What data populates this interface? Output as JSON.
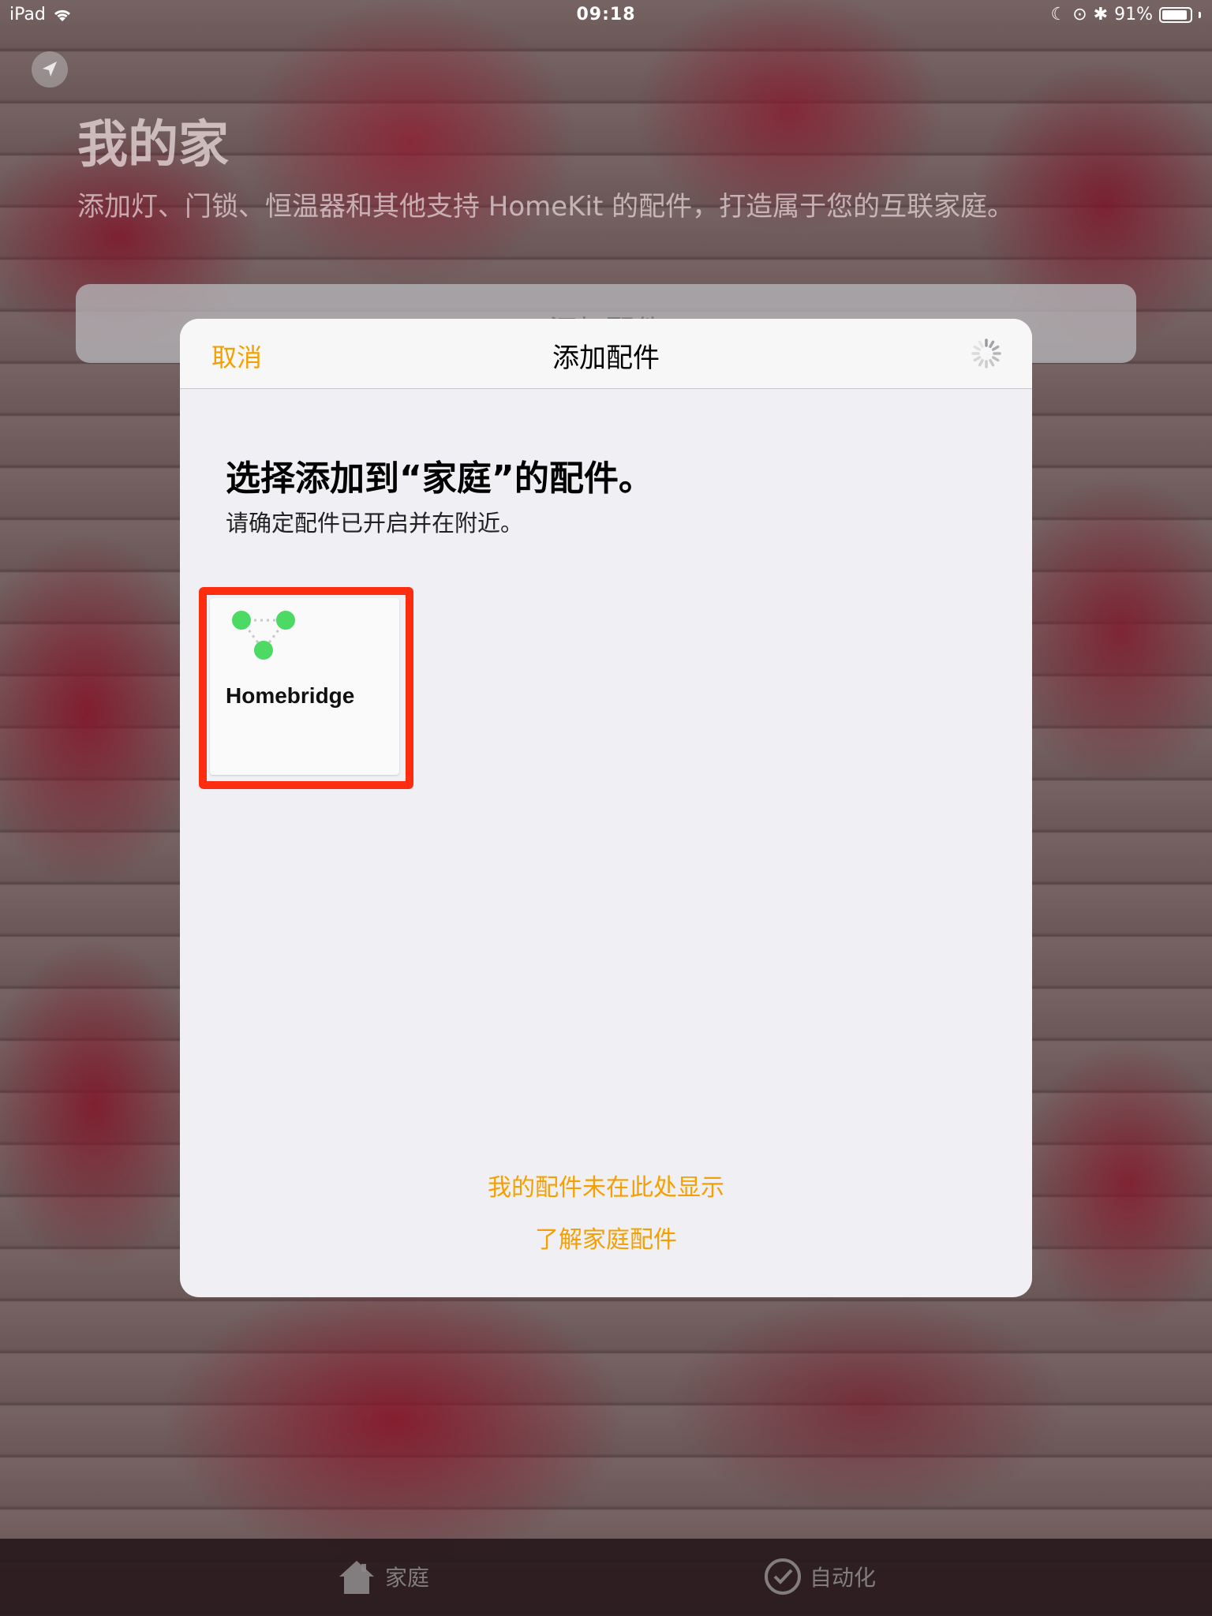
{
  "status_bar": {
    "device": "iPad",
    "time": "09:18",
    "battery_percent": "91%",
    "battery_level": 0.91
  },
  "background_header": {
    "title": "我的家",
    "subtitle": "添加灯、门锁、恒温器和其他支持 HomeKit 的配件，打造属于您的互联家庭。",
    "add_button_label": "添加配件"
  },
  "sheet": {
    "cancel_label": "取消",
    "title": "添加配件",
    "prompt_title": "选择添加到“家庭”的配件。",
    "prompt_subtitle": "请确定配件已开启并在附近。",
    "accessories": [
      {
        "name": "Homebridge",
        "icon": "homebridge-icon",
        "highlighted": true
      }
    ],
    "link_not_shown": "我的配件未在此处显示",
    "link_learn_more": "了解家庭配件"
  },
  "tab_bar": {
    "tabs": [
      {
        "label": "家庭",
        "icon": "house-icon"
      },
      {
        "label": "自动化",
        "icon": "automation-check-icon"
      }
    ]
  },
  "colors": {
    "accent": "#f5a000",
    "highlight_border": "#ff2d0f",
    "icon_green": "#4cd964"
  }
}
